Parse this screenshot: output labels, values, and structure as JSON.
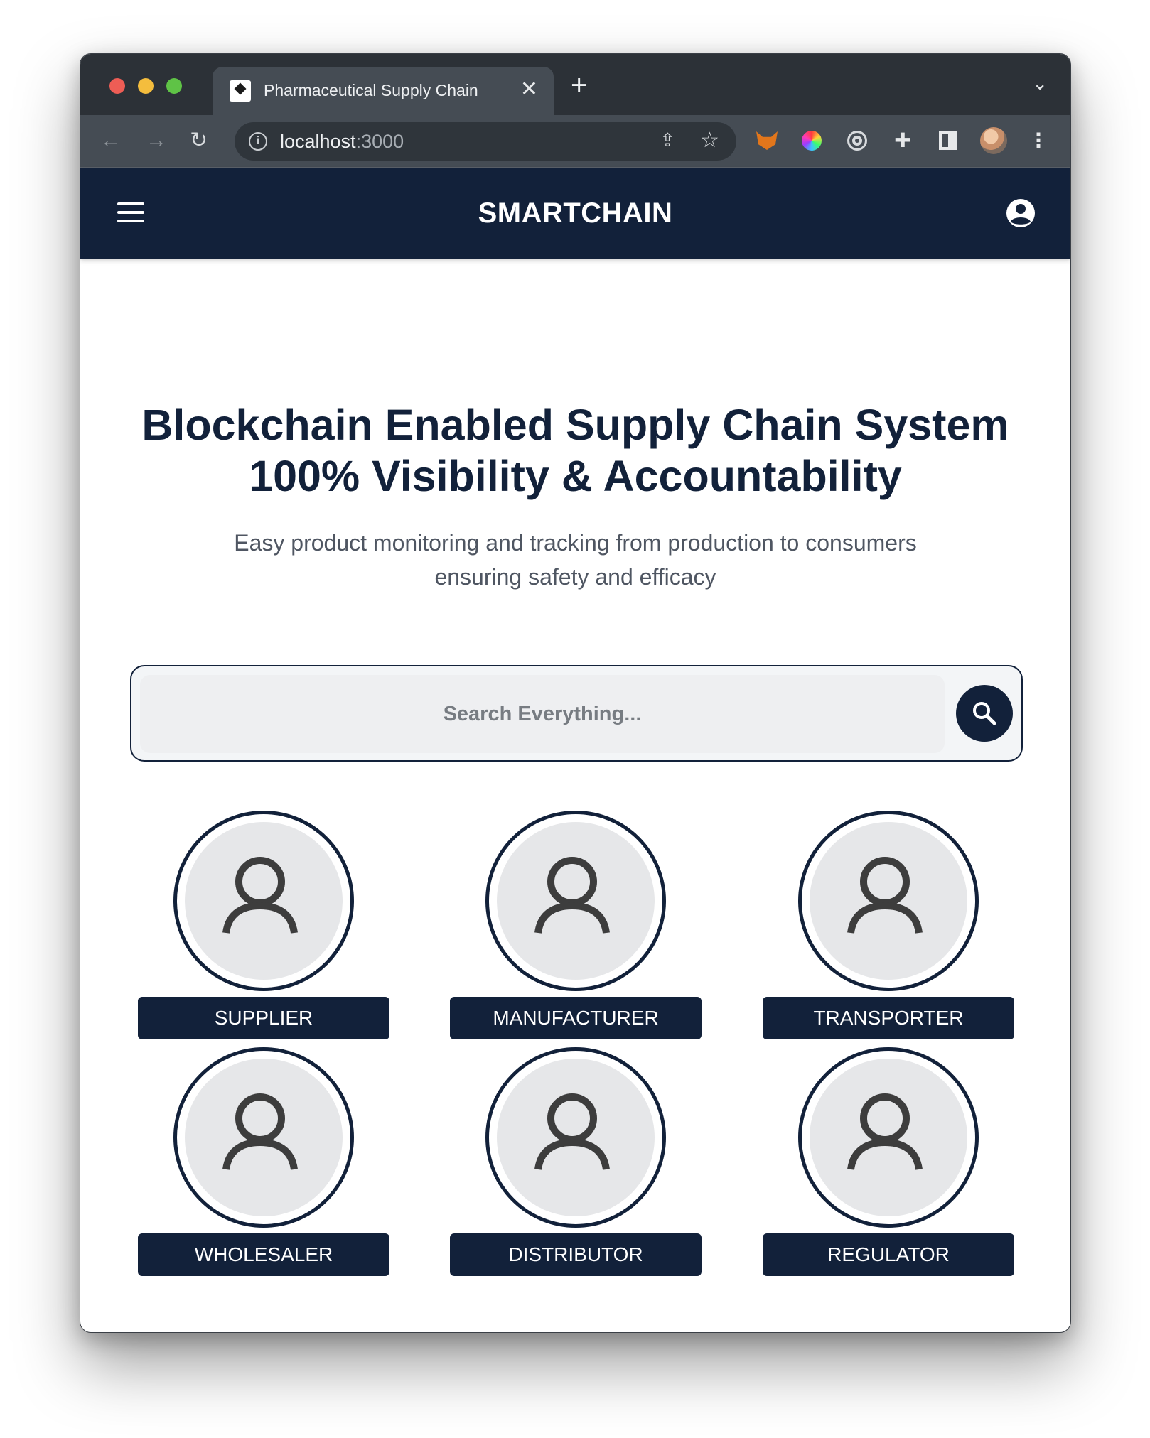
{
  "browser": {
    "tab_title": "Pharmaceutical Supply Chain",
    "tab_close": "✕",
    "new_tab": "+",
    "url_host": "localhost",
    "url_port": ":3000"
  },
  "app": {
    "brand": "SMARTCHAIN",
    "hero_title_line1": "Blockchain Enabled Supply Chain System",
    "hero_title_line2": "100% Visibility & Accountability",
    "hero_sub_line1": "Easy product monitoring and tracking from production to consumers",
    "hero_sub_line2": "ensuring safety and efficacy",
    "search_placeholder": "Search Everything...",
    "roles": [
      {
        "label": "SUPPLIER"
      },
      {
        "label": "MANUFACTURER"
      },
      {
        "label": "TRANSPORTER"
      },
      {
        "label": "WHOLESALER"
      },
      {
        "label": "DISTRIBUTOR"
      },
      {
        "label": "REGULATOR"
      }
    ]
  },
  "colors": {
    "navy": "#12213a",
    "avatar_bg": "#e6e7e9",
    "chrome_dark": "#2c3137",
    "chrome_toolbar": "#454c54"
  },
  "icons": {
    "menu": "hamburger-icon",
    "account": "account-circle-icon",
    "search": "magnifier-icon",
    "role": "person-outline-icon"
  }
}
